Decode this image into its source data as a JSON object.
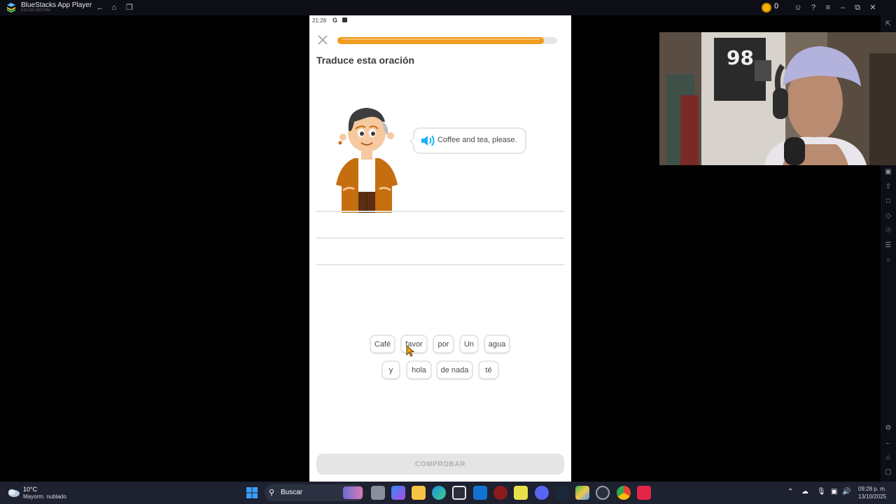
{
  "window": {
    "app_title": "BlueStacks App Player",
    "version": "5.22.110.1027 P64",
    "coins": "0"
  },
  "status_bar": {
    "time": "21:28"
  },
  "lesson": {
    "progress": 0.94,
    "prompt": "Traduce esta oración",
    "speech_text": "Coffee and tea, please.",
    "word_bank_row1": [
      "Café",
      "favor",
      "por",
      "Un",
      "agua"
    ],
    "word_bank_row2": [
      "y",
      "hola",
      "de nada",
      "té"
    ],
    "check_label": "COMPROBAR"
  },
  "taskbar": {
    "weather_temp": "10°C",
    "weather_desc": "Mayorm. nublado",
    "search_placeholder": "Buscar",
    "clock_time": "09:28 p. m.",
    "clock_date": "13/10/2025"
  },
  "colors": {
    "progress": "#f29b1d",
    "accent_blue": "#1cb0f6",
    "check_disabled_bg": "#e5e5e5",
    "check_disabled_text": "#afafaf"
  }
}
